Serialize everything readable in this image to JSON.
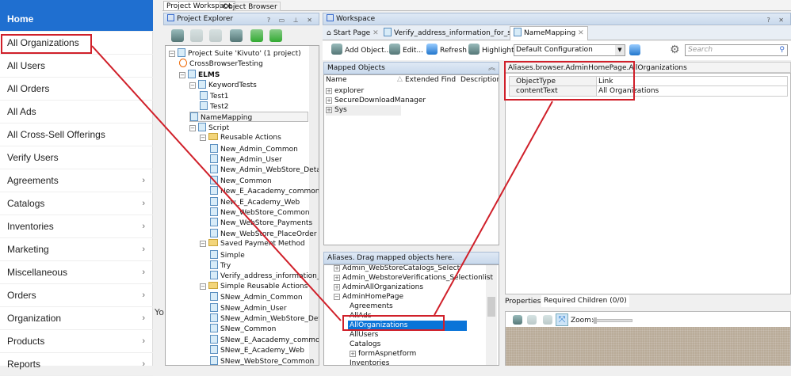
{
  "nav": {
    "items": [
      {
        "label": "Home",
        "chevron": false
      },
      {
        "label": "All Organizations",
        "chevron": false
      },
      {
        "label": "All Users",
        "chevron": false
      },
      {
        "label": "All Orders",
        "chevron": false
      },
      {
        "label": "All Ads",
        "chevron": false
      },
      {
        "label": "All Cross-Sell Offerings",
        "chevron": false
      },
      {
        "label": "Verify Users",
        "chevron": false
      },
      {
        "label": "Agreements",
        "chevron": true
      },
      {
        "label": "Catalogs",
        "chevron": true
      },
      {
        "label": "Inventories",
        "chevron": true
      },
      {
        "label": "Marketing",
        "chevron": true
      },
      {
        "label": "Miscellaneous",
        "chevron": true
      },
      {
        "label": "Orders",
        "chevron": true
      },
      {
        "label": "Organization",
        "chevron": true
      },
      {
        "label": "Products",
        "chevron": true
      },
      {
        "label": "Reports",
        "chevron": true
      }
    ],
    "chevron_glyph": "›",
    "cut_text": "Yo"
  },
  "ide": {
    "top_tabs": [
      "Project Workspace",
      "Object Browser"
    ],
    "explorer": {
      "title": "Project Explorer",
      "tree": [
        {
          "label": "Project Suite 'Kivuto' (1 project)",
          "level": 0,
          "type": "suite"
        },
        {
          "label": "CrossBrowserTesting",
          "level": 1,
          "type": "cbt"
        },
        {
          "label": "ELMS",
          "level": 1,
          "type": "project",
          "bold": true
        },
        {
          "label": "KeywordTests",
          "level": 2,
          "type": "folder"
        },
        {
          "label": "Test1",
          "level": 3,
          "type": "file"
        },
        {
          "label": "Test2",
          "level": 3,
          "type": "file"
        },
        {
          "label": "NameMapping",
          "level": 2,
          "type": "file",
          "selected": true
        },
        {
          "label": "Script",
          "level": 2,
          "type": "folder"
        },
        {
          "label": "Reusable Actions",
          "level": 3,
          "type": "open"
        },
        {
          "label": "New_Admin_Common",
          "level": 4,
          "type": "file"
        },
        {
          "label": "New_Admin_User",
          "level": 4,
          "type": "file"
        },
        {
          "label": "New_Admin_WebStore_Details",
          "level": 4,
          "type": "file"
        },
        {
          "label": "New_Common",
          "level": 4,
          "type": "file"
        },
        {
          "label": "New_E_Aacademy_common",
          "level": 4,
          "type": "file"
        },
        {
          "label": "New_E_Academy_Web",
          "level": 4,
          "type": "file"
        },
        {
          "label": "New_WebStore_Common",
          "level": 4,
          "type": "file"
        },
        {
          "label": "New_WebStore_Payments",
          "level": 4,
          "type": "file"
        },
        {
          "label": "New_WebStore_PlaceOrder",
          "level": 4,
          "type": "file"
        },
        {
          "label": "Saved Payment Method",
          "level": 3,
          "type": "open"
        },
        {
          "label": "Simple",
          "level": 4,
          "type": "file"
        },
        {
          "label": "Try",
          "level": 4,
          "type": "file"
        },
        {
          "label": "Verify_address_information_fo",
          "level": 4,
          "type": "file"
        },
        {
          "label": "Simple Reusable Actions",
          "level": 3,
          "type": "open"
        },
        {
          "label": "SNew_Admin_Common",
          "level": 4,
          "type": "file"
        },
        {
          "label": "SNew_Admin_User",
          "level": 4,
          "type": "file"
        },
        {
          "label": "SNew_Admin_WebStore_Deta",
          "level": 4,
          "type": "file"
        },
        {
          "label": "SNew_Common",
          "level": 4,
          "type": "file"
        },
        {
          "label": "SNew_E_Aacademy_common",
          "level": 4,
          "type": "file"
        },
        {
          "label": "SNew_E_Academy_Web",
          "level": 4,
          "type": "file"
        },
        {
          "label": "SNew_WebStore_Common",
          "level": 4,
          "type": "file"
        }
      ]
    },
    "workspace": {
      "title": "Workspace",
      "tabs": [
        "Start Page",
        "Verify_address_information_for_s...",
        "NameMapping"
      ],
      "toolbar": {
        "add": "Add Object...",
        "edit": "Edit...",
        "refresh": "Refresh",
        "highlight": "Highlight",
        "config": "Default Configuration",
        "search_placeholder": "Search"
      },
      "mapped": {
        "title": "Mapped Objects",
        "columns": [
          "Name",
          "Extended Find",
          "Description"
        ],
        "items": [
          "explorer",
          "SecureDownloadManager",
          "Sys"
        ]
      },
      "aliases": {
        "title": "Aliases. Drag mapped objects here.",
        "items": [
          {
            "label": "Admin_WebStoreCatalogs_Select",
            "expand": true,
            "level": 0
          },
          {
            "label": "Admin_WebstoreVerifications_Selectionlist",
            "expand": true,
            "level": 0
          },
          {
            "label": "AdminAllOrganizations",
            "expand": true,
            "level": 0
          },
          {
            "label": "AdminHomePage",
            "expand": "open",
            "level": 0
          },
          {
            "label": "Agreements",
            "level": 1
          },
          {
            "label": "AllAds",
            "level": 1
          },
          {
            "label": "AllOrganizations",
            "level": 1,
            "selected": true
          },
          {
            "label": "AllUsers",
            "level": 1
          },
          {
            "label": "Catalogs",
            "level": 1
          },
          {
            "label": "formAspnetform",
            "expand": true,
            "level": 1
          },
          {
            "label": "Inventories",
            "level": 1
          }
        ]
      },
      "detail": {
        "path": "Aliases.browser.AdminHomePage.AllOrganizations",
        "rows": [
          {
            "key": "ObjectType",
            "value": "Link"
          },
          {
            "key": "contentText",
            "value": "All Organizations"
          }
        ]
      },
      "bottom_tabs": [
        "Properties",
        "Required Children (0/0)"
      ],
      "zoom_label": "Zoom:"
    }
  },
  "colors": {
    "accent": "#1f6fd0",
    "annotation": "#d0202a",
    "selection": "#0a74d8"
  }
}
